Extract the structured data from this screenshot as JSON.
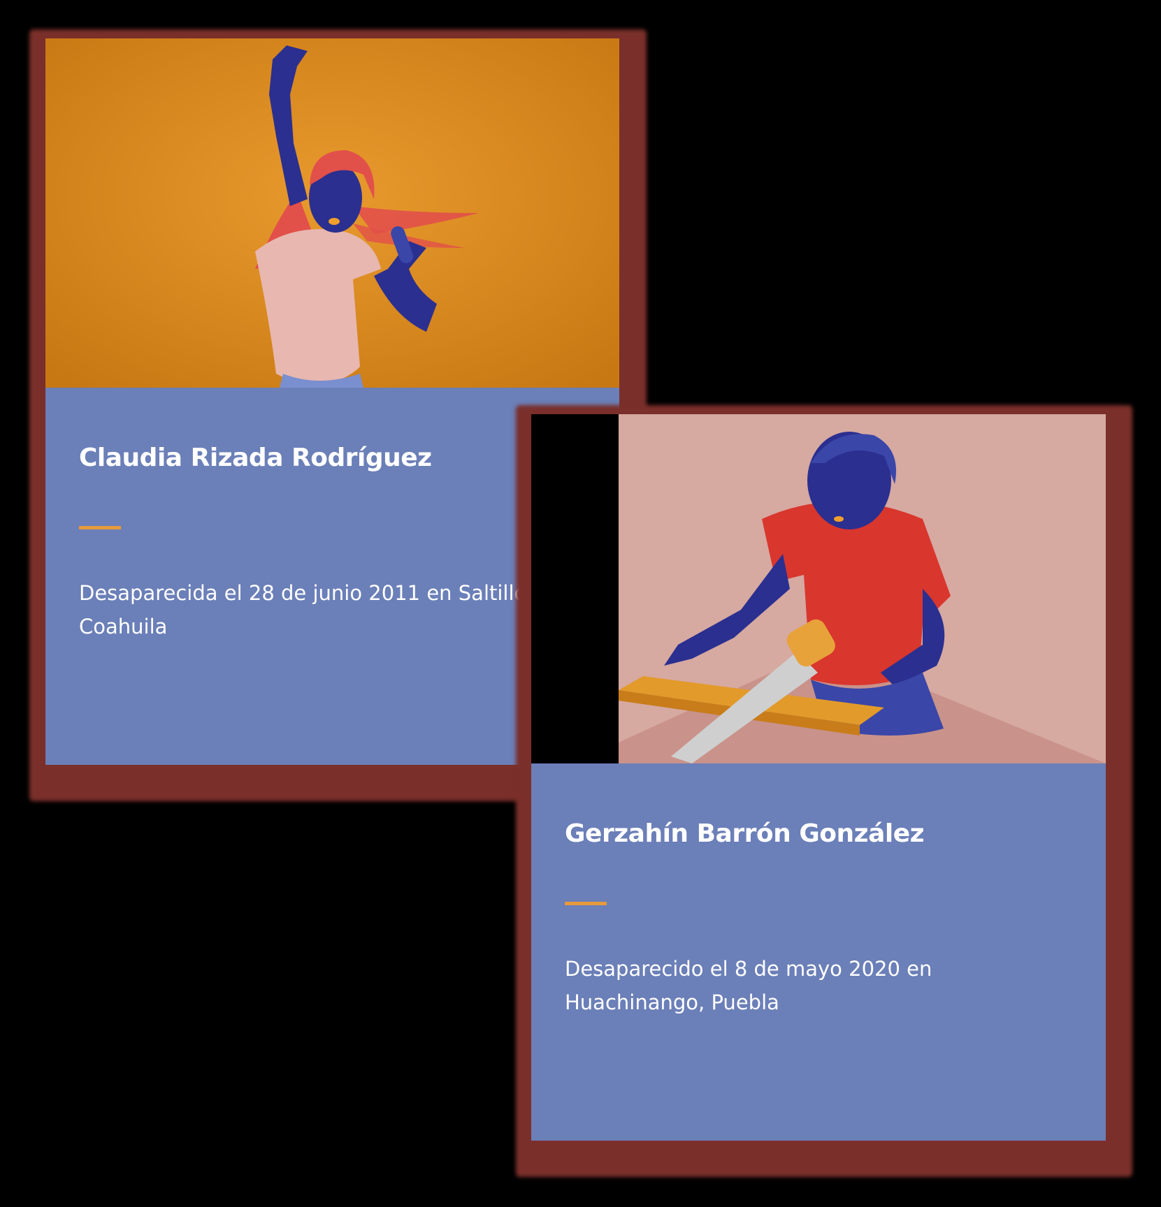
{
  "cards": [
    {
      "name": "Claudia Rizada Rodríguez",
      "description": "Desaparecida el 28 de junio 2011 en Saltillo, Coahuila",
      "illustration": "woman-singing-into-hairbrush"
    },
    {
      "name": "Gerzahín Barrón González",
      "description": "Desaparecido el 8 de mayo 2020 en Huachinango, Puebla",
      "illustration": "man-sawing-wood"
    }
  ],
  "colors": {
    "background": "#000000",
    "shadow": "#7a2f2a",
    "card": "#6b7fb8",
    "accent": "#e59a3c",
    "illustration_one_bg": "#d98a22",
    "illustration_two_bg": "#d8aaa3"
  }
}
